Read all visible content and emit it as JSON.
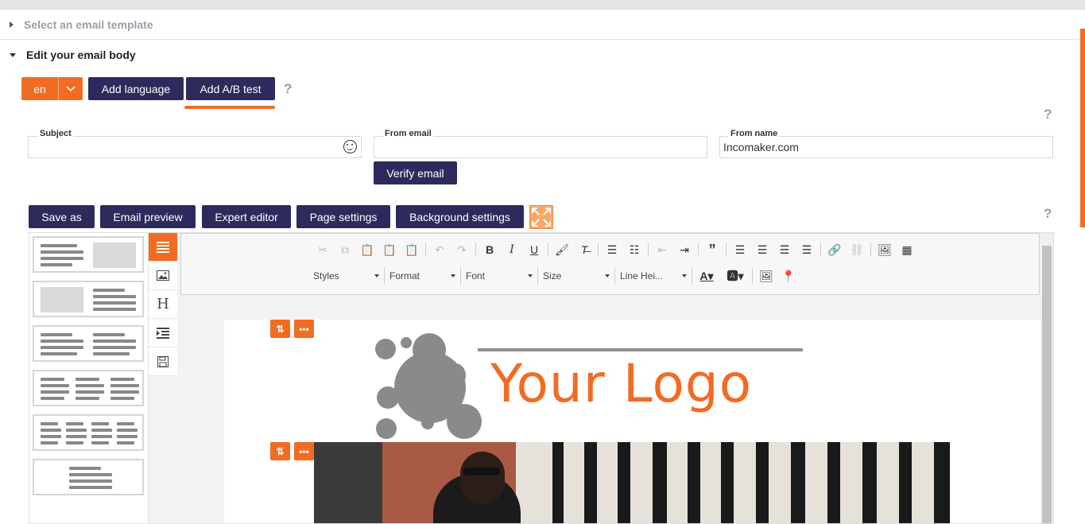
{
  "sections": {
    "template": {
      "label": "Select an email template"
    },
    "body": {
      "label": "Edit your email body"
    }
  },
  "language": {
    "selected": "en"
  },
  "actions": {
    "add_language": "Add language",
    "add_ab": "Add A/B test",
    "help": "?"
  },
  "fields": {
    "subject": {
      "label": "Subject",
      "value": ""
    },
    "from_email": {
      "label": "From email",
      "value": ""
    },
    "from_name": {
      "label": "From name",
      "value": "Incomaker.com"
    },
    "verify": "Verify email"
  },
  "toolbar": {
    "save_as": "Save as",
    "email_preview": "Email preview",
    "expert_editor": "Expert editor",
    "page_settings": "Page settings",
    "background_settings": "Background settings"
  },
  "side_tabs": [
    "H"
  ],
  "ck": {
    "styles": "Styles",
    "format": "Format",
    "font": "Font",
    "size": "Size",
    "line_height": "Line Hei..."
  },
  "logo": {
    "text": "Your Logo"
  },
  "colors": {
    "accent": "#f26b22",
    "navy": "#2d2b5c"
  }
}
